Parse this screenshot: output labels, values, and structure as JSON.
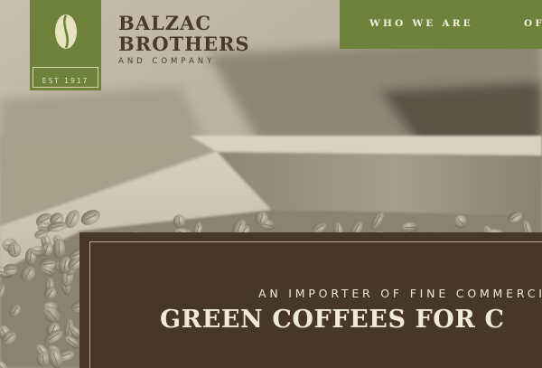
{
  "logo": {
    "est_label": "EST 1917",
    "icon": "coffee-bean-icon"
  },
  "brand": {
    "line1": "BALZAC",
    "line2": "BROTHERS",
    "subtitle": "AND COMPANY"
  },
  "nav": {
    "items": [
      {
        "label": "WHO WE ARE"
      },
      {
        "label": "OF"
      }
    ]
  },
  "hero": {
    "kicker": "AN IMPORTER OF FINE COMMERCIA",
    "headline": "GREEN COFFEES FOR C"
  },
  "colors": {
    "olive": "#6f823c",
    "dark_brown": "#47372b",
    "cream": "#f1ead6",
    "brand_text": "#4a3a2d"
  }
}
